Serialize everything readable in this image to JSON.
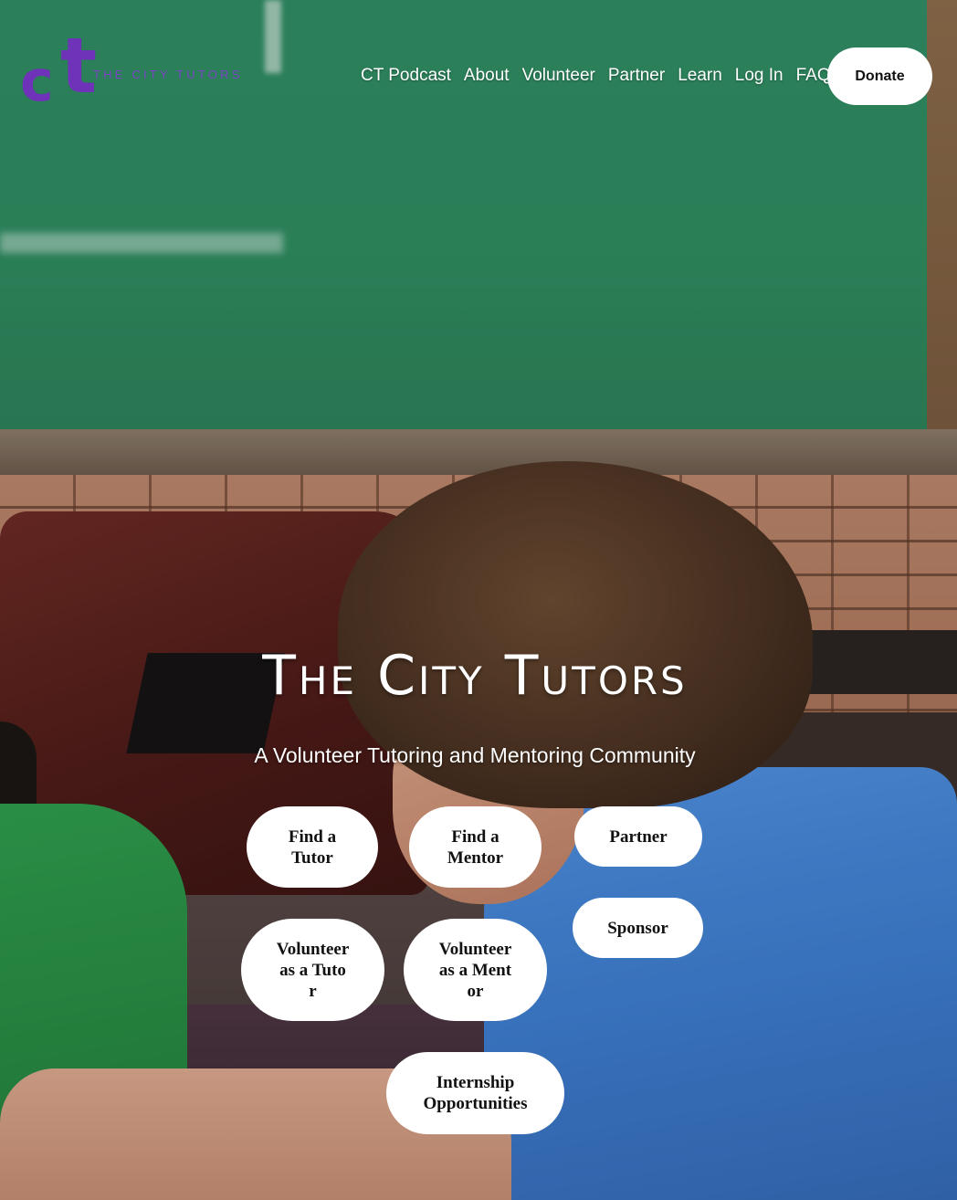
{
  "header": {
    "logo": {
      "monogram_c": "c",
      "monogram_t": "t",
      "name": "THE CITY TUTORS"
    },
    "nav": [
      {
        "label": "CT Podcast"
      },
      {
        "label": "About"
      },
      {
        "label": "Volunteer"
      },
      {
        "label": "Partner"
      },
      {
        "label": "Learn"
      },
      {
        "label": "Log In"
      },
      {
        "label": "FAQs"
      }
    ],
    "donate_label": "Donate"
  },
  "hero": {
    "title": "The City Tutors",
    "subtitle": "A Volunteer Tutoring and Mentoring Community",
    "buttons": {
      "find_tutor": "Find a Tutor",
      "find_mentor": "Find a Mentor",
      "partner": "Partner",
      "sponsor": "Sponsor",
      "volunteer_tutor": "Volunteer as a Tutor",
      "volunteer_mentor": "Volunteer as a Mentor",
      "internship": "Internship Opportunities"
    }
  },
  "colors": {
    "brand_purple": "#6e33b8",
    "button_bg": "#ffffff",
    "nav_text": "#ffffff"
  }
}
